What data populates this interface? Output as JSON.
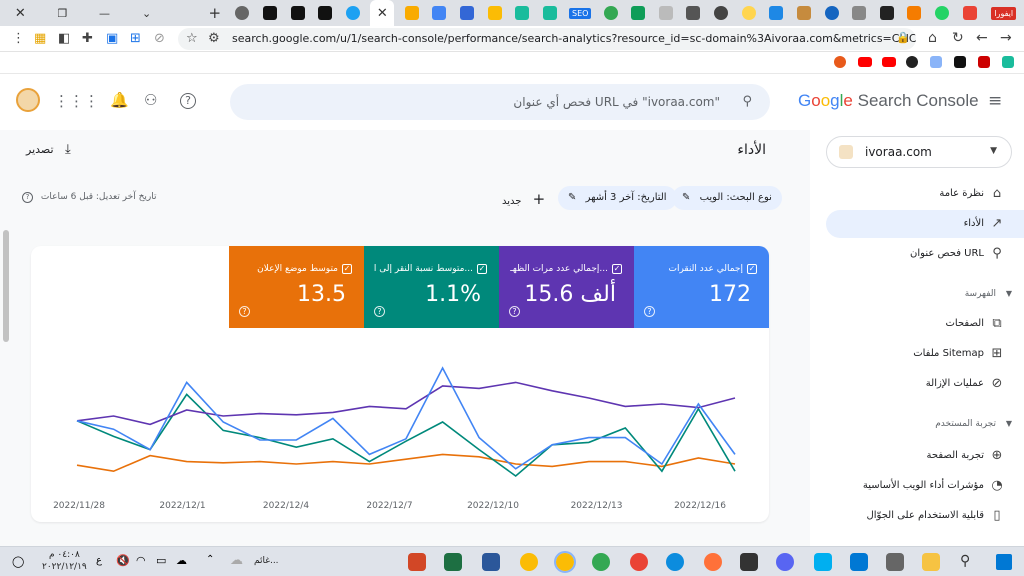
{
  "browser": {
    "url": "search.google.com/u/1/search-console/performance/search-analytics?resource_id=sc-domain%3Aivoraa.com&metrics=CLICKS%2CIMPRESSI...",
    "tab_label": "SEO",
    "ext_badge": "ايفورا"
  },
  "header": {
    "search_placeholder": "فحص أي عنوان URL في \"ivoraa.com\"",
    "logo_google": "Google",
    "logo_product": "Search Console"
  },
  "sidebar": {
    "property": "ivoraa.com",
    "items": [
      {
        "label": "نظرة عامة"
      },
      {
        "label": "الأداء"
      },
      {
        "label": "فحص عنوان URL"
      }
    ],
    "section_indexing": "الفهرسة",
    "indexing_items": [
      {
        "label": "الصفحات"
      },
      {
        "label": "ملفات Sitemap"
      },
      {
        "label": "عمليات الإزالة"
      }
    ],
    "section_experience": "تجربة المستخدم",
    "experience_items": [
      {
        "label": "تجربة الصفحة"
      },
      {
        "label": "مؤشرات أداء الويب الأساسية"
      },
      {
        "label": "قابلية الاستخدام على الجوّال"
      }
    ]
  },
  "main": {
    "title": "الأداء",
    "export_label": "تصدير",
    "filter_search_type": "نوع البحث: الويب",
    "filter_date": "التاريخ: آخر 3 أشهر",
    "new_label": "جديد",
    "last_updated": "تاريخ آخر تعديل: قبل 6 ساعات"
  },
  "metrics": [
    {
      "label": "إجمالي عدد النقرات",
      "value": "172",
      "color": "#4285f4"
    },
    {
      "label": "إجمالي عدد مرات الظهـ...",
      "value": "15.6 ألف",
      "color": "#5e35b1"
    },
    {
      "label": "متوسط نسبة النقر إلى ا...",
      "value": "1.1%",
      "color": "#00897b"
    },
    {
      "label": "متوسط موضع الإعلان",
      "value": "13.5",
      "color": "#e8710a"
    }
  ],
  "chart_data": {
    "type": "line",
    "x_ticks": [
      "2022/11/28",
      "2022/12/1",
      "2022/12/4",
      "2022/12/7",
      "2022/12/10",
      "2022/12/13",
      "2022/12/16"
    ],
    "series": [
      {
        "name": "إجمالي عدد النقرات",
        "color": "#4285f4",
        "values": [
          46,
          39,
          22,
          78,
          45,
          30,
          30,
          48,
          18,
          31,
          90,
          32,
          6,
          26,
          32,
          32,
          10,
          60,
          18
        ]
      },
      {
        "name": "إجمالي عدد مرات الظهـ...",
        "color": "#5e35b1",
        "values": [
          46,
          50,
          43,
          55,
          50,
          52,
          51,
          53,
          58,
          56,
          75,
          73,
          78,
          71,
          65,
          58,
          60,
          57,
          65
        ]
      },
      {
        "name": "متوسط نسبة النقر إلى ا...",
        "color": "#00897b",
        "values": [
          46,
          33,
          22,
          68,
          38,
          32,
          24,
          31,
          12,
          29,
          45,
          22,
          0,
          26,
          28,
          40,
          4,
          56,
          4
        ]
      },
      {
        "name": "متوسط موضع الإعلان",
        "color": "#e8710a",
        "values": [
          9,
          4,
          17,
          12,
          11,
          12,
          10,
          12,
          10,
          14,
          18,
          16,
          10,
          8,
          12,
          12,
          8,
          15,
          10
        ]
      }
    ]
  },
  "taskbar": {
    "time": "٠٤:٠٨ م",
    "date": "٢٠٢٢/١٢/١٩",
    "weather": "غائم..."
  }
}
